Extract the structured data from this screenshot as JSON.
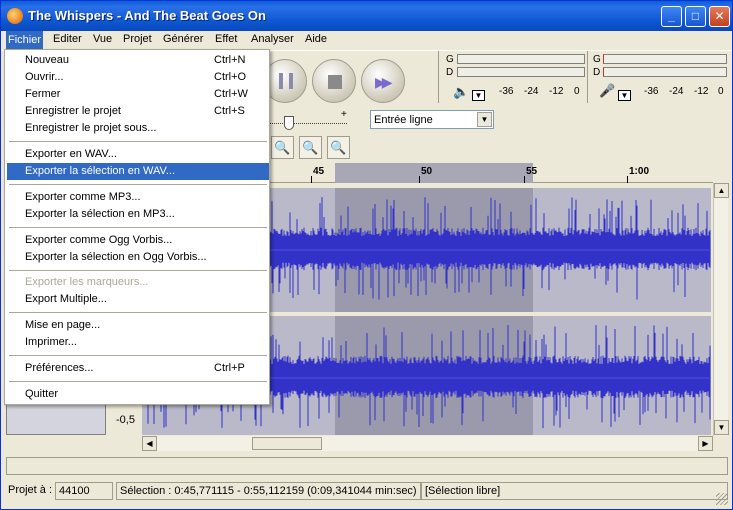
{
  "window": {
    "title": "The Whispers - And The Beat Goes On"
  },
  "titlebar_buttons": {
    "minimize": "_",
    "maximize": "□",
    "close": "✕"
  },
  "menubar": [
    {
      "label": "Fichier",
      "active": true
    },
    {
      "label": "Editer"
    },
    {
      "label": "Vue"
    },
    {
      "label": "Projet"
    },
    {
      "label": "Générer"
    },
    {
      "label": "Effet"
    },
    {
      "label": "Analyser"
    },
    {
      "label": "Aide"
    }
  ],
  "file_menu": [
    {
      "label": "Nouveau",
      "shortcut": "Ctrl+N"
    },
    {
      "label": "Ouvrir...",
      "shortcut": "Ctrl+O"
    },
    {
      "label": "Fermer",
      "shortcut": "Ctrl+W"
    },
    {
      "label": "Enregistrer le projet",
      "shortcut": "Ctrl+S"
    },
    {
      "label": "Enregistrer le projet sous..."
    },
    {
      "label": "Exporter en WAV..."
    },
    {
      "label": "Exporter la sélection en WAV...",
      "highlighted": true
    },
    {
      "label": "Exporter comme MP3..."
    },
    {
      "label": "Exporter la sélection en MP3..."
    },
    {
      "label": "Exporter comme Ogg Vorbis..."
    },
    {
      "label": "Exporter la sélection en Ogg Vorbis..."
    },
    {
      "label": "Exporter les marqueurs...",
      "disabled": true
    },
    {
      "label": "Export Multiple..."
    },
    {
      "label": "Mise en page..."
    },
    {
      "label": "Imprimer..."
    },
    {
      "label": "Préférences...",
      "shortcut": "Ctrl+P"
    },
    {
      "label": "Quitter"
    }
  ],
  "meters": {
    "playback": {
      "channel_left": "G",
      "channel_right": "D",
      "scale": [
        "-36",
        "-24",
        "-12",
        "0"
      ],
      "icon": "speaker-icon"
    },
    "record": {
      "channel_left": "G",
      "channel_right": "D",
      "scale": [
        "-36",
        "-24",
        "-12",
        "0"
      ],
      "icon": "microphone-icon"
    }
  },
  "mixer": {
    "input_source": "Entrée ligne",
    "plus": "+"
  },
  "ruler": {
    "labels": [
      "45",
      "50",
      "55",
      "1:00"
    ]
  },
  "track": {
    "scale_label": "-0,5"
  },
  "status": {
    "rate_label": "Projet à :",
    "rate_value": "44100",
    "selection": "Sélection : 0:45,771115 - 0:55,112159 (0:09,341044 min:sec)",
    "mode": "[Sélection libre]"
  },
  "colors": {
    "waveform": "#3232c8",
    "selection": "#9a9aac",
    "menu_highlight": "#316ac5"
  }
}
